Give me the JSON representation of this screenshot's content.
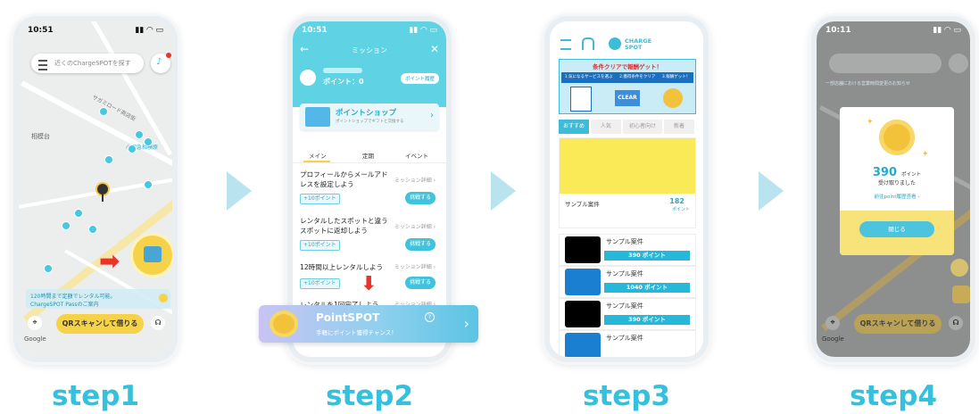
{
  "steps": [
    {
      "label": "step1"
    },
    {
      "label": "step2"
    },
    {
      "label": "step3"
    },
    {
      "label": "step4"
    }
  ],
  "colors": {
    "accent": "#35c0de",
    "arrow": "#b9e4ef",
    "red": "#e8352b",
    "yellow": "#f6d249"
  },
  "step1": {
    "time": "10:51",
    "search_placeholder": "近くのChargeSPOTを探す",
    "map_labels": [
      "相模台",
      "小田急相模原",
      "サガミロード商店街"
    ],
    "banner_line1": "120時間まで定額でレンタル可能。",
    "banner_line2": "ChargeSPOT Passのご案内",
    "qr_button": "QRスキャンして借りる",
    "google": "Google"
  },
  "step2": {
    "time": "10:51",
    "title": "ミッション",
    "points": "ポイント：0",
    "points_history": "ポイント履歴",
    "shop_title": "ポイントショップ",
    "shop_sub": "ポイントショップでギフトと交換する",
    "tabs": [
      "メイン",
      "定期",
      "イベント"
    ],
    "missions": [
      {
        "title_line1": "プロフィールからメールアド",
        "title_line2": "レスを設定しよう",
        "badge": "+10ポイント",
        "detail": "ミッション詳細 ›",
        "button": "挑戦する"
      },
      {
        "title_line1": "レンタルしたスポットと違う",
        "title_line2": "スポットに返却しよう",
        "badge": "+10ポイント",
        "detail": "ミッション詳細 ›",
        "button": "挑戦する"
      },
      {
        "title_line1": "12時間以上レンタルしよう",
        "title_line2": "",
        "badge": "+10ポイント",
        "detail": "ミッション詳細 ›",
        "button": "挑戦する"
      },
      {
        "title_line1": "レンタルを1回完了しよう",
        "title_line2": "",
        "badge": "",
        "detail": "ミッション詳細 ›",
        "button": ""
      }
    ],
    "popup_title": "PointSPOT",
    "popup_sub": "手軽にポイント獲得チャンス！"
  },
  "step3": {
    "logo": "CHARGE SPOT",
    "menu_label": "MENU",
    "home_label": "HOME",
    "hero_title": "条件クリアで報酬ゲット！",
    "hero_steps": [
      "1.気になるサービスを選ぶ",
      "2.獲得条件をクリア",
      "3.報酬ゲット！"
    ],
    "hero_clear": "CLEAR",
    "tabs": [
      "おすすめ",
      "人気",
      "初心者向け",
      "新着"
    ],
    "featured_name": "サンプル案件",
    "featured_points": "182",
    "featured_unit": "ポイント",
    "cases": [
      {
        "name": "サンプル案件",
        "points": "390 ポイント",
        "color": "#000000"
      },
      {
        "name": "サンプル案件",
        "points": "1040 ポイント",
        "color": "#1a7fd1"
      },
      {
        "name": "サンプル案件",
        "points": "390 ポイント",
        "color": "#000000"
      },
      {
        "name": "サンプル案件",
        "points": "",
        "color": "#1a7fd1"
      }
    ]
  },
  "step4": {
    "time": "10:11",
    "notice": "一部店舗における営業時間変更のお知らせ",
    "points_value": "390",
    "points_unit": "ポイント",
    "received": "受け取りました",
    "history_link": "前往point履歴查看 ›",
    "close_button": "閉じる",
    "qr_button": "QRスキャンして借りる",
    "google": "Google"
  }
}
